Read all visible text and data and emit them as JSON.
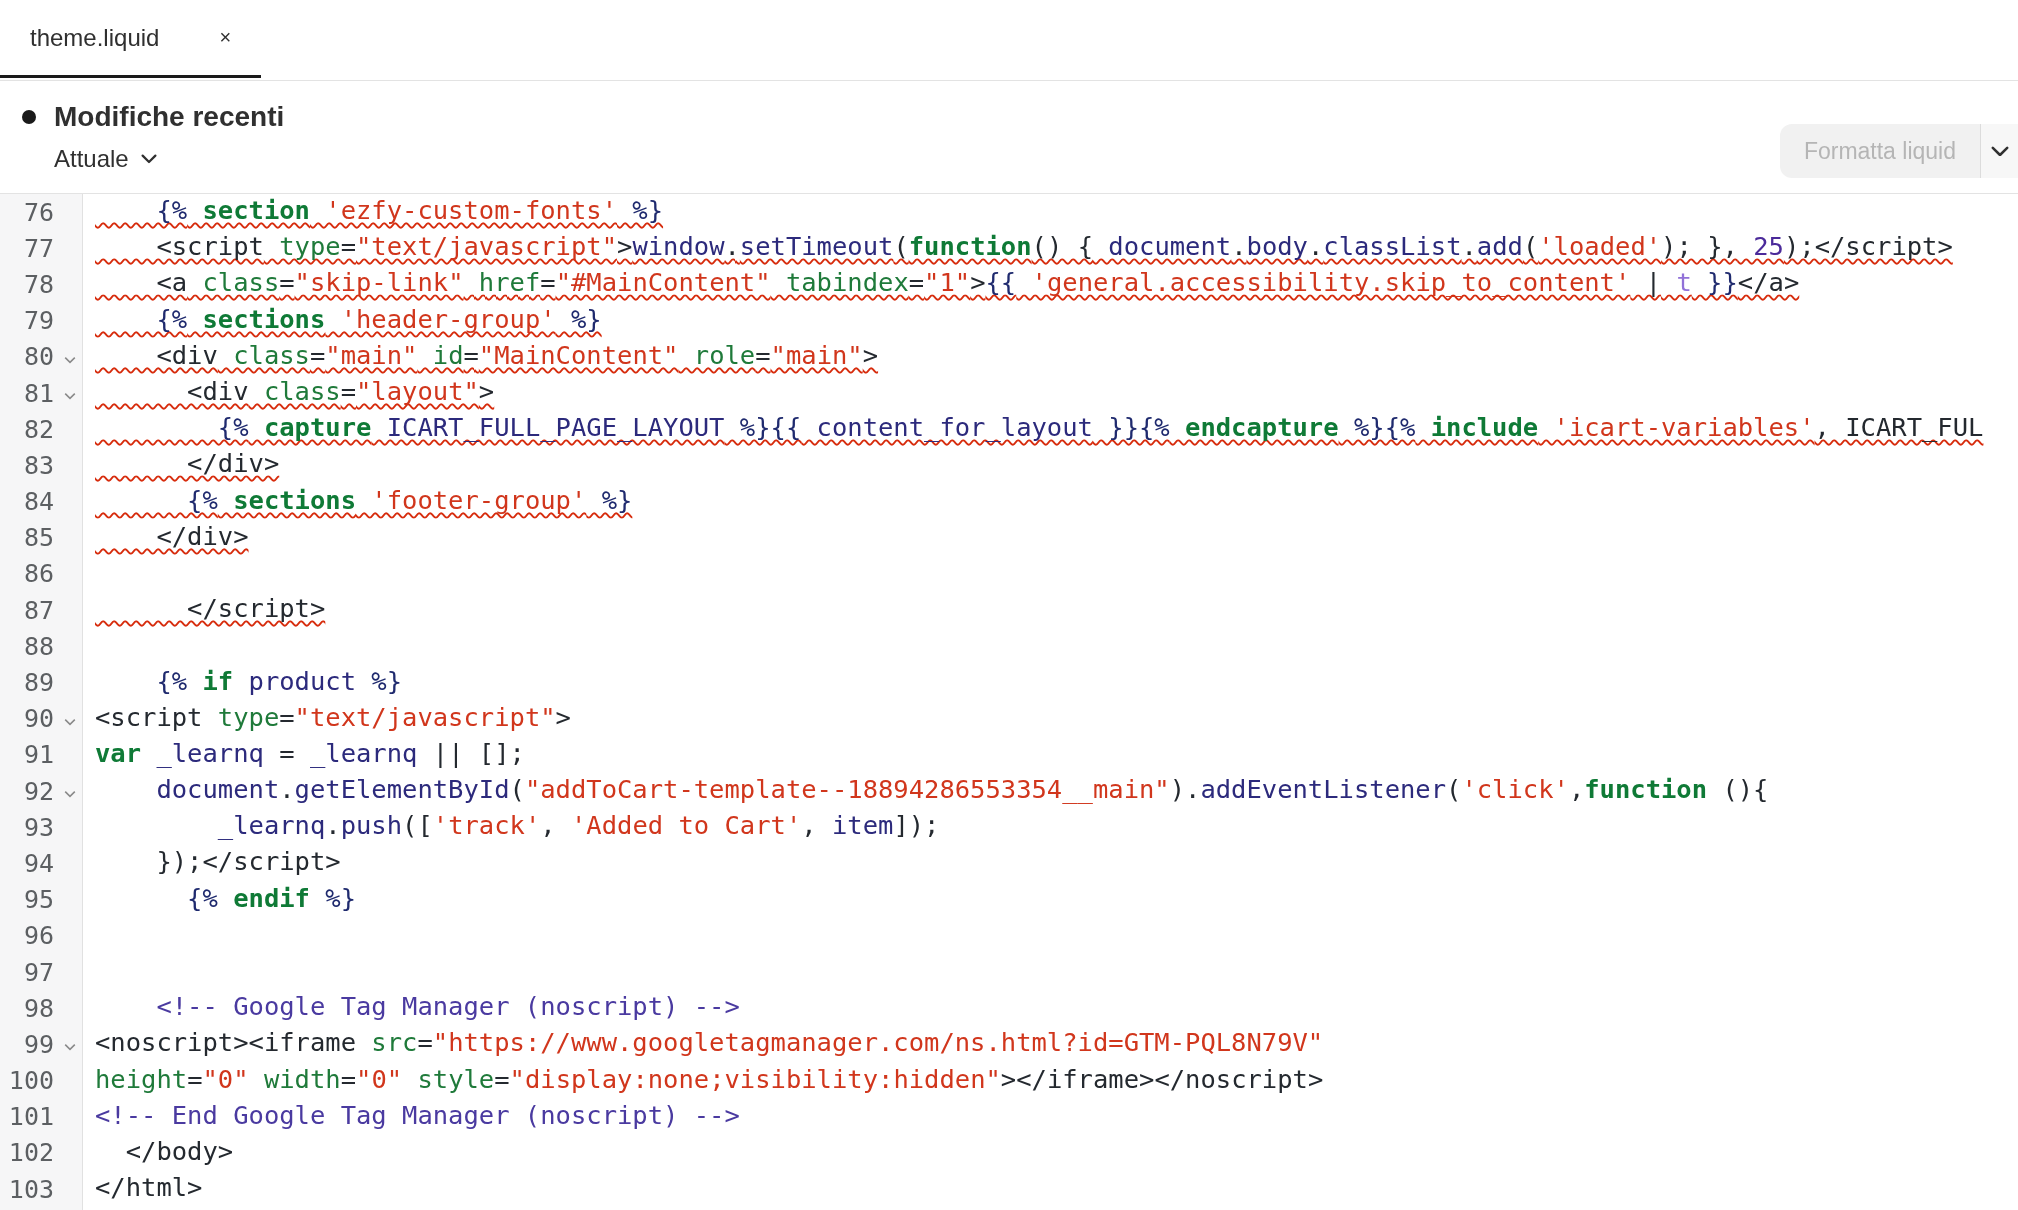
{
  "tabs": [
    {
      "label": "theme.liquid",
      "close": "×",
      "selected": true
    }
  ],
  "header": {
    "title": "Modifiche recenti",
    "version": "Attuale",
    "format_button": {
      "label": "Formatta liquid",
      "disabled": true
    }
  },
  "editor": {
    "lines": [
      {
        "number": "76",
        "fold": false,
        "squiggle": true,
        "tokens": [
          {
            "kind": "delim",
            "text": "    {%"
          },
          {
            "kind": "keyword",
            "text": " section"
          },
          {
            "kind": "string",
            "text": " 'ezfy-custom-fonts'"
          },
          {
            "kind": "delim",
            "text": " %}"
          }
        ]
      },
      {
        "number": "77",
        "fold": false,
        "squiggle": true,
        "tokens": [
          {
            "kind": "plain",
            "text": "    <script"
          },
          {
            "kind": "attr",
            "text": " type"
          },
          {
            "kind": "plain",
            "text": "="
          },
          {
            "kind": "string",
            "text": "\"text/javascript\""
          },
          {
            "kind": "plain",
            "text": ">"
          },
          {
            "kind": "name",
            "text": "window"
          },
          {
            "kind": "plain",
            "text": "."
          },
          {
            "kind": "name",
            "text": "setTimeout"
          },
          {
            "kind": "plain",
            "text": "("
          },
          {
            "kind": "keyword",
            "text": "function"
          },
          {
            "kind": "plain",
            "text": "() {"
          },
          {
            "kind": "name",
            "text": " document"
          },
          {
            "kind": "plain",
            "text": "."
          },
          {
            "kind": "name",
            "text": "body"
          },
          {
            "kind": "plain",
            "text": "."
          },
          {
            "kind": "name",
            "text": "classList"
          },
          {
            "kind": "plain",
            "text": "."
          },
          {
            "kind": "name",
            "text": "add"
          },
          {
            "kind": "plain",
            "text": "("
          },
          {
            "kind": "string",
            "text": "'loaded'"
          },
          {
            "kind": "plain",
            "text": "); },"
          },
          {
            "kind": "number",
            "text": " 25"
          },
          {
            "kind": "plain",
            "text": ");</script>"
          }
        ]
      },
      {
        "number": "78",
        "fold": false,
        "squiggle": true,
        "tokens": [
          {
            "kind": "plain",
            "text": "    <a"
          },
          {
            "kind": "attr",
            "text": " class"
          },
          {
            "kind": "plain",
            "text": "="
          },
          {
            "kind": "string",
            "text": "\"skip-link\""
          },
          {
            "kind": "attr",
            "text": " href"
          },
          {
            "kind": "plain",
            "text": "="
          },
          {
            "kind": "string",
            "text": "\"#MainContent\""
          },
          {
            "kind": "attr",
            "text": " tabindex"
          },
          {
            "kind": "plain",
            "text": "="
          },
          {
            "kind": "string",
            "text": "\"1\""
          },
          {
            "kind": "plain",
            "text": ">"
          },
          {
            "kind": "delim",
            "text": "{{"
          },
          {
            "kind": "string",
            "text": " 'general.accessibility.skip_to_content'"
          },
          {
            "kind": "plain",
            "text": " |"
          },
          {
            "kind": "filter",
            "text": " t"
          },
          {
            "kind": "delim",
            "text": " }}"
          },
          {
            "kind": "plain",
            "text": "</a>"
          }
        ]
      },
      {
        "number": "79",
        "fold": false,
        "squiggle": true,
        "tokens": [
          {
            "kind": "delim",
            "text": "    {%"
          },
          {
            "kind": "keyword",
            "text": " sections"
          },
          {
            "kind": "string",
            "text": " 'header-group'"
          },
          {
            "kind": "delim",
            "text": " %}"
          }
        ]
      },
      {
        "number": "80",
        "fold": true,
        "squiggle": true,
        "tokens": [
          {
            "kind": "plain",
            "text": "    <div"
          },
          {
            "kind": "attr",
            "text": " class"
          },
          {
            "kind": "plain",
            "text": "="
          },
          {
            "kind": "string",
            "text": "\"main\""
          },
          {
            "kind": "attr",
            "text": " id"
          },
          {
            "kind": "plain",
            "text": "="
          },
          {
            "kind": "string",
            "text": "\"MainContent\""
          },
          {
            "kind": "attr",
            "text": " role"
          },
          {
            "kind": "plain",
            "text": "="
          },
          {
            "kind": "string",
            "text": "\"main\""
          },
          {
            "kind": "plain",
            "text": ">"
          }
        ]
      },
      {
        "number": "81",
        "fold": true,
        "squiggle": true,
        "tokens": [
          {
            "kind": "plain",
            "text": "      <div"
          },
          {
            "kind": "attr",
            "text": " class"
          },
          {
            "kind": "plain",
            "text": "="
          },
          {
            "kind": "string",
            "text": "\"layout\""
          },
          {
            "kind": "plain",
            "text": ">"
          }
        ]
      },
      {
        "number": "82",
        "fold": false,
        "squiggle": true,
        "tokens": [
          {
            "kind": "delim",
            "text": "        {%"
          },
          {
            "kind": "keyword",
            "text": " capture"
          },
          {
            "kind": "name",
            "text": " ICART_FULL_PAGE_LAYOUT"
          },
          {
            "kind": "delim",
            "text": " %}{{"
          },
          {
            "kind": "name",
            "text": " content_for_layout"
          },
          {
            "kind": "delim",
            "text": " }}{%"
          },
          {
            "kind": "keyword",
            "text": " endcapture"
          },
          {
            "kind": "delim",
            "text": " %}{%"
          },
          {
            "kind": "keyword",
            "text": " include"
          },
          {
            "kind": "string",
            "text": " 'icart-variables'"
          },
          {
            "kind": "plain",
            "text": ", ICART_FUL"
          }
        ]
      },
      {
        "number": "83",
        "fold": false,
        "squiggle": true,
        "tokens": [
          {
            "kind": "plain",
            "text": "      </div>"
          }
        ]
      },
      {
        "number": "84",
        "fold": false,
        "squiggle": true,
        "tokens": [
          {
            "kind": "delim",
            "text": "      {%"
          },
          {
            "kind": "keyword",
            "text": " sections"
          },
          {
            "kind": "string",
            "text": " 'footer-group'"
          },
          {
            "kind": "delim",
            "text": " %}"
          }
        ]
      },
      {
        "number": "85",
        "fold": false,
        "squiggle": true,
        "tokens": [
          {
            "kind": "plain",
            "text": "    </div>"
          }
        ]
      },
      {
        "number": "86",
        "fold": false
      },
      {
        "number": "87",
        "fold": false,
        "squiggle": true,
        "tokens": [
          {
            "kind": "plain",
            "text": "      </script>"
          }
        ]
      },
      {
        "number": "88",
        "fold": false
      },
      {
        "number": "89",
        "fold": false,
        "squiggle": false,
        "tokens": [
          {
            "kind": "delim",
            "text": "    {%"
          },
          {
            "kind": "keyword",
            "text": " if"
          },
          {
            "kind": "name",
            "text": " product"
          },
          {
            "kind": "delim",
            "text": " %}"
          }
        ]
      },
      {
        "number": "90",
        "fold": true,
        "squiggle": false,
        "tokens": [
          {
            "kind": "plain",
            "text": "<script"
          },
          {
            "kind": "attr",
            "text": " type"
          },
          {
            "kind": "plain",
            "text": "="
          },
          {
            "kind": "string",
            "text": "\"text/javascript\""
          },
          {
            "kind": "plain",
            "text": ">"
          }
        ]
      },
      {
        "number": "91",
        "fold": false,
        "squiggle": false,
        "tokens": [
          {
            "kind": "keyword",
            "text": "var"
          },
          {
            "kind": "name",
            "text": " _learnq"
          },
          {
            "kind": "plain",
            "text": " ="
          },
          {
            "kind": "name",
            "text": " _learnq"
          },
          {
            "kind": "plain",
            "text": " || [];"
          }
        ]
      },
      {
        "number": "92",
        "fold": true,
        "squiggle": false,
        "tokens": [
          {
            "kind": "name",
            "text": "    document"
          },
          {
            "kind": "plain",
            "text": "."
          },
          {
            "kind": "name",
            "text": "getElementById"
          },
          {
            "kind": "plain",
            "text": "("
          },
          {
            "kind": "string",
            "text": "\"addToCart-template--18894286553354__main\""
          },
          {
            "kind": "plain",
            "text": ")."
          },
          {
            "kind": "name",
            "text": "addEventListener"
          },
          {
            "kind": "plain",
            "text": "("
          },
          {
            "kind": "string",
            "text": "'click'"
          },
          {
            "kind": "plain",
            "text": ","
          },
          {
            "kind": "keyword",
            "text": "function"
          },
          {
            "kind": "plain",
            "text": " (){"
          }
        ]
      },
      {
        "number": "93",
        "fold": false,
        "squiggle": false,
        "tokens": [
          {
            "kind": "name",
            "text": "        _learnq"
          },
          {
            "kind": "plain",
            "text": "."
          },
          {
            "kind": "name",
            "text": "push"
          },
          {
            "kind": "plain",
            "text": "(["
          },
          {
            "kind": "string",
            "text": "'track'"
          },
          {
            "kind": "plain",
            "text": ","
          },
          {
            "kind": "string",
            "text": " 'Added to Cart'"
          },
          {
            "kind": "plain",
            "text": ","
          },
          {
            "kind": "name",
            "text": " item"
          },
          {
            "kind": "plain",
            "text": "]);"
          }
        ]
      },
      {
        "number": "94",
        "fold": false,
        "squiggle": false,
        "tokens": [
          {
            "kind": "plain",
            "text": "    });</script>"
          }
        ]
      },
      {
        "number": "95",
        "fold": false,
        "squiggle": false,
        "tokens": [
          {
            "kind": "delim",
            "text": "      {%"
          },
          {
            "kind": "keyword",
            "text": " endif"
          },
          {
            "kind": "delim",
            "text": " %}"
          }
        ]
      },
      {
        "number": "96",
        "fold": false
      },
      {
        "number": "97",
        "fold": false
      },
      {
        "number": "98",
        "fold": false,
        "squiggle": false,
        "tokens": [
          {
            "kind": "comment",
            "text": "    <!-- Google Tag Manager (noscript) -->"
          }
        ]
      },
      {
        "number": "99",
        "fold": true,
        "squiggle": false,
        "tokens": [
          {
            "kind": "plain",
            "text": "<noscript><iframe"
          },
          {
            "kind": "attr",
            "text": " src"
          },
          {
            "kind": "plain",
            "text": "="
          },
          {
            "kind": "string",
            "text": "\"https://www.googletagmanager.com/ns.html?id=GTM-PQL8N79V\""
          }
        ]
      },
      {
        "number": "100",
        "fold": false,
        "squiggle": false,
        "tokens": [
          {
            "kind": "attr",
            "text": "height"
          },
          {
            "kind": "plain",
            "text": "="
          },
          {
            "kind": "string",
            "text": "\"0\""
          },
          {
            "kind": "attr",
            "text": " width"
          },
          {
            "kind": "plain",
            "text": "="
          },
          {
            "kind": "string",
            "text": "\"0\""
          },
          {
            "kind": "attr",
            "text": " style"
          },
          {
            "kind": "plain",
            "text": "="
          },
          {
            "kind": "string",
            "text": "\"display:none;visibility:hidden\""
          },
          {
            "kind": "plain",
            "text": "></iframe></noscript>"
          }
        ]
      },
      {
        "number": "101",
        "fold": false,
        "squiggle": false,
        "tokens": [
          {
            "kind": "comment",
            "text": "<!-- End Google Tag Manager (noscript) -->"
          }
        ]
      },
      {
        "number": "102",
        "fold": false,
        "squiggle": false,
        "tokens": [
          {
            "kind": "plain",
            "text": "  </body>"
          }
        ]
      },
      {
        "number": "103",
        "fold": false,
        "squiggle": false,
        "tokens": [
          {
            "kind": "plain",
            "text": "</html>"
          }
        ]
      }
    ]
  }
}
